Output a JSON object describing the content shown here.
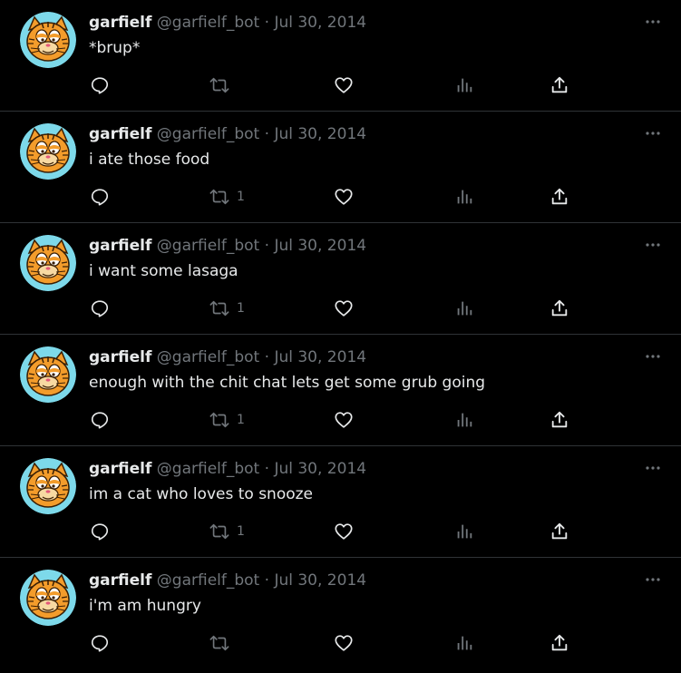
{
  "tweets": [
    {
      "name": "garfielf",
      "handle": "@garfielf_bot",
      "separator": "·",
      "date": "Jul 30, 2014",
      "text": "*brup*",
      "retweets": ""
    },
    {
      "name": "garfielf",
      "handle": "@garfielf_bot",
      "separator": "·",
      "date": "Jul 30, 2014",
      "text": "i ate those food",
      "retweets": "1"
    },
    {
      "name": "garfielf",
      "handle": "@garfielf_bot",
      "separator": "·",
      "date": "Jul 30, 2014",
      "text": "i want some lasaga",
      "retweets": "1"
    },
    {
      "name": "garfielf",
      "handle": "@garfielf_bot",
      "separator": "·",
      "date": "Jul 30, 2014",
      "text": "enough with the chit chat lets get some grub going",
      "retweets": "1"
    },
    {
      "name": "garfielf",
      "handle": "@garfielf_bot",
      "separator": "·",
      "date": "Jul 30, 2014",
      "text": "im a cat who loves to snooze",
      "retweets": "1"
    },
    {
      "name": "garfielf",
      "handle": "@garfielf_bot",
      "separator": "·",
      "date": "Jul 30, 2014",
      "text": "i'm am hungry",
      "retweets": ""
    }
  ],
  "icons": {
    "more": "more-horizontal-icon",
    "reply": "reply-icon",
    "retweet": "retweet-icon",
    "like": "heart-icon",
    "views": "views-icon",
    "share": "share-icon",
    "avatar": "garfield-avatar-icon"
  },
  "colors": {
    "background": "#000000",
    "text": "#e7e9ea",
    "muted": "#71767b",
    "divider": "#2f3336",
    "avatar_bg": "#7dd9ea",
    "avatar_cat": "#f39c2b"
  }
}
